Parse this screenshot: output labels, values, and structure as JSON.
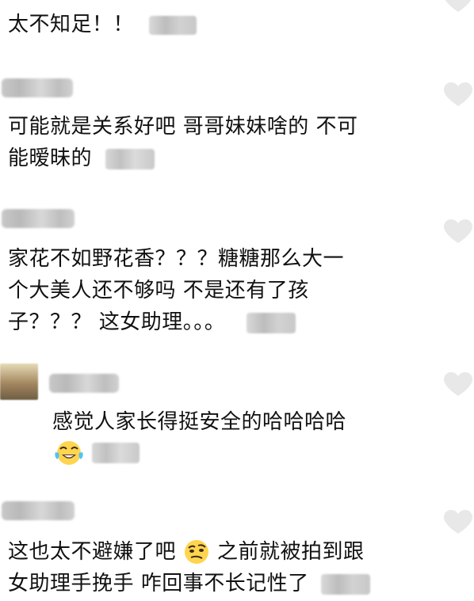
{
  "comments": [
    {
      "text": "太不知足！！"
    },
    {
      "line1": "可能就是关系好吧 哥哥妹妹啥的 不可",
      "line2": "能暧昧的"
    },
    {
      "line1": "家花不如野花香？？？糖糖那么大一",
      "line2": "个大美人还不够吗 不是还有了孩",
      "line3": "子？？？ 这女助理。。。"
    },
    {
      "reply": "感觉人家长得挺安全的哈哈哈哈"
    },
    {
      "line1_prefix": "这也太不避嫌了吧",
      "line1_suffix": "之前就被拍到跟",
      "line2": "女助理手挽手 咋回事不长记性了"
    }
  ],
  "icons": {
    "heart": "heart-icon",
    "laugh": "laughing-tears-emoji",
    "skeptical": "skeptical-face-emoji"
  },
  "colors": {
    "text": "#111111",
    "heart": "#e8e8e8",
    "background": "#ffffff"
  }
}
